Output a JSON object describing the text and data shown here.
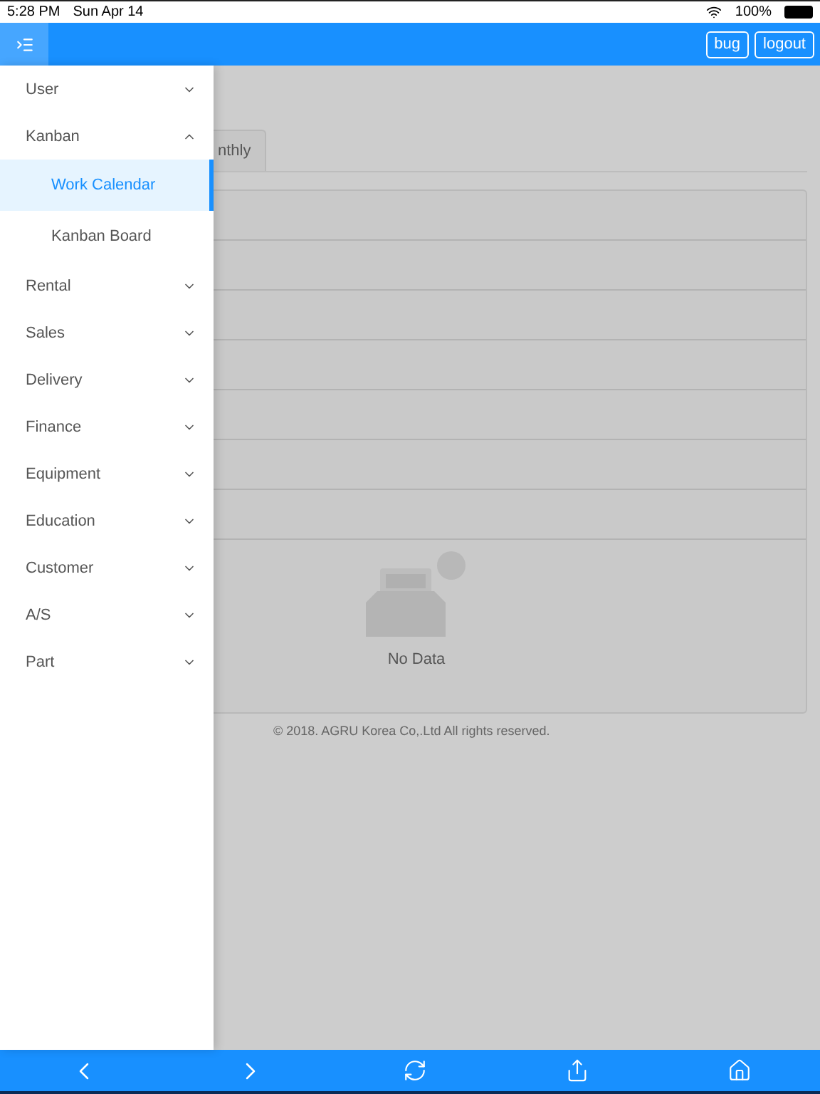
{
  "status_bar": {
    "time": "5:28 PM",
    "date": "Sun Apr 14",
    "battery": "100%"
  },
  "header": {
    "buttons": [
      "bug",
      "logout"
    ]
  },
  "menu": [
    {
      "label": "User",
      "expanded": false
    },
    {
      "label": "Kanban",
      "expanded": true,
      "children": [
        {
          "label": "Work Calendar",
          "selected": true
        },
        {
          "label": "Kanban Board",
          "selected": false
        }
      ]
    },
    {
      "label": "Rental",
      "expanded": false
    },
    {
      "label": "Sales",
      "expanded": false
    },
    {
      "label": "Delivery",
      "expanded": false
    },
    {
      "label": "Finance",
      "expanded": false
    },
    {
      "label": "Equipment",
      "expanded": false
    },
    {
      "label": "Education",
      "expanded": false
    },
    {
      "label": "Customer",
      "expanded": false
    },
    {
      "label": "A/S",
      "expanded": false
    },
    {
      "label": "Part",
      "expanded": false
    }
  ],
  "tab": {
    "label": "nthly"
  },
  "empty_state": {
    "text": "No Data"
  },
  "footer": "© 2018. AGRU Korea Co,.Ltd All rights reserved."
}
